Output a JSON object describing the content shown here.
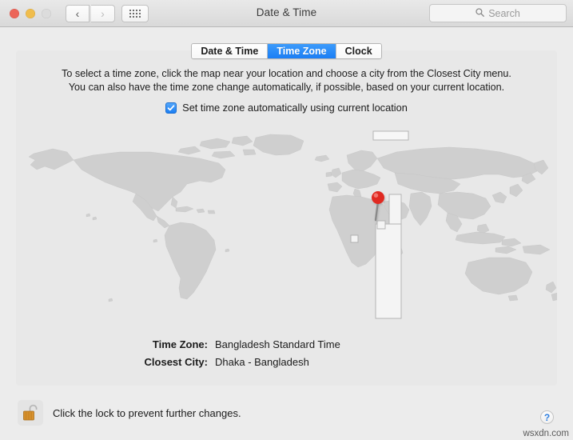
{
  "window": {
    "title": "Date & Time",
    "traffic_lights": [
      "close",
      "minimize",
      "zoom"
    ],
    "nav": {
      "back": "‹",
      "forward": "›"
    },
    "grid_button": "show-all-icon"
  },
  "search": {
    "placeholder": "Search",
    "icon": "search-icon"
  },
  "tabs": [
    {
      "label": "Date & Time",
      "active": false
    },
    {
      "label": "Time Zone",
      "active": true
    },
    {
      "label": "Clock",
      "active": false
    }
  ],
  "description": {
    "line1": "To select a time zone, click the map near your location and choose a city from the Closest City menu.",
    "line2": "You can also have the time zone change automatically, if possible, based on your current location."
  },
  "auto_timezone": {
    "label": "Set time zone automatically using current location",
    "checked": true,
    "checkbox_color": "#1b7ef3"
  },
  "map": {
    "background_color": "#e8e8e8",
    "land_color": "#cfcfcf",
    "highlight_band_color": "#f4f4f4",
    "pin_color": "#e02b21",
    "pin_label": "location-pin",
    "selected_band_label": "highlighted-time-zone-band"
  },
  "info": {
    "time_zone_label": "Time Zone:",
    "time_zone_value": "Bangladesh Standard Time",
    "closest_city_label": "Closest City:",
    "closest_city_value": "Dhaka - Bangladesh"
  },
  "footer": {
    "lock_icon": "unlocked-padlock-icon",
    "lock_text": "Click the lock to prevent further changes.",
    "help_label": "?",
    "watermark": "wsxdn.com"
  }
}
